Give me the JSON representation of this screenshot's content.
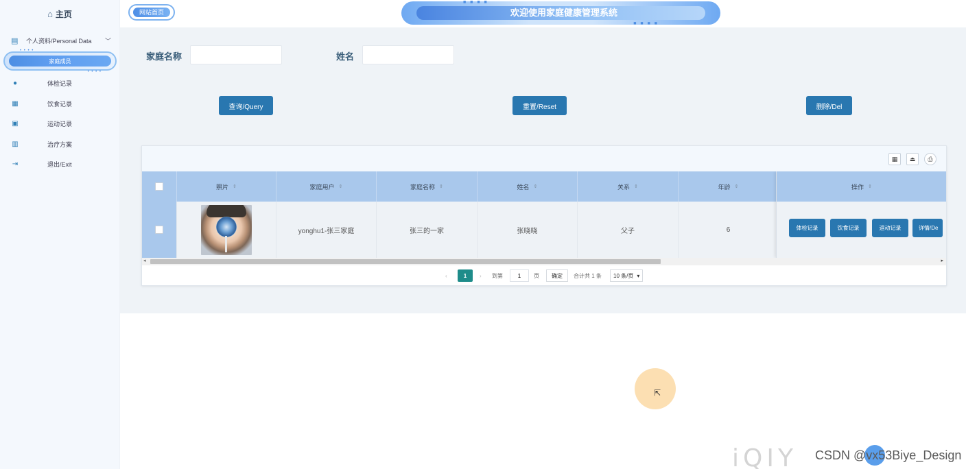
{
  "sidebar": {
    "home_label": "主页",
    "group_label": "个人资料/Personal Data",
    "active_sub": "家庭成员",
    "items": [
      {
        "label": "体检记录",
        "icon": "user-badge-icon"
      },
      {
        "label": "饮食记录",
        "icon": "calendar-icon"
      },
      {
        "label": "运动记录",
        "icon": "calendar-check-icon"
      },
      {
        "label": "治疗方案",
        "icon": "book-icon"
      },
      {
        "label": "退出/Exit",
        "icon": "logout-icon"
      }
    ]
  },
  "header": {
    "home_link": "网站首页",
    "title": "欢迎使用家庭健康管理系统"
  },
  "search": {
    "family_name_label": "家庭名称",
    "family_name_value": "",
    "name_label": "姓名",
    "name_value": ""
  },
  "actions": {
    "query": "查询/Query",
    "reset": "重置/Reset",
    "delete": "删除/Del"
  },
  "table": {
    "columns": [
      "照片",
      "家庭用户",
      "家庭名称",
      "姓名",
      "关系",
      "年龄",
      "操作"
    ],
    "rows": [
      {
        "user": "yonghu1-张三家庭",
        "family_name": "张三的一家",
        "name": "张晓晓",
        "relation": "父子",
        "age": "6"
      }
    ],
    "row_actions": [
      "体检记录",
      "饮食记录",
      "运动记录",
      "详情/De"
    ]
  },
  "pagination": {
    "current_page": "1",
    "goto_label": "到第",
    "goto_value": "1",
    "page_suffix": "页",
    "confirm": "确定",
    "total": "合计共 1 条",
    "page_size": "10 条/页"
  },
  "watermark": {
    "text": "CSDN @vx53Biye_Design"
  },
  "colors": {
    "primary_button": "#2977b0",
    "table_header": "#a9c8ec",
    "page_active": "#1e8c8a",
    "sidebar_bg": "#f4f8fd",
    "content_bg": "#eff3f7"
  }
}
